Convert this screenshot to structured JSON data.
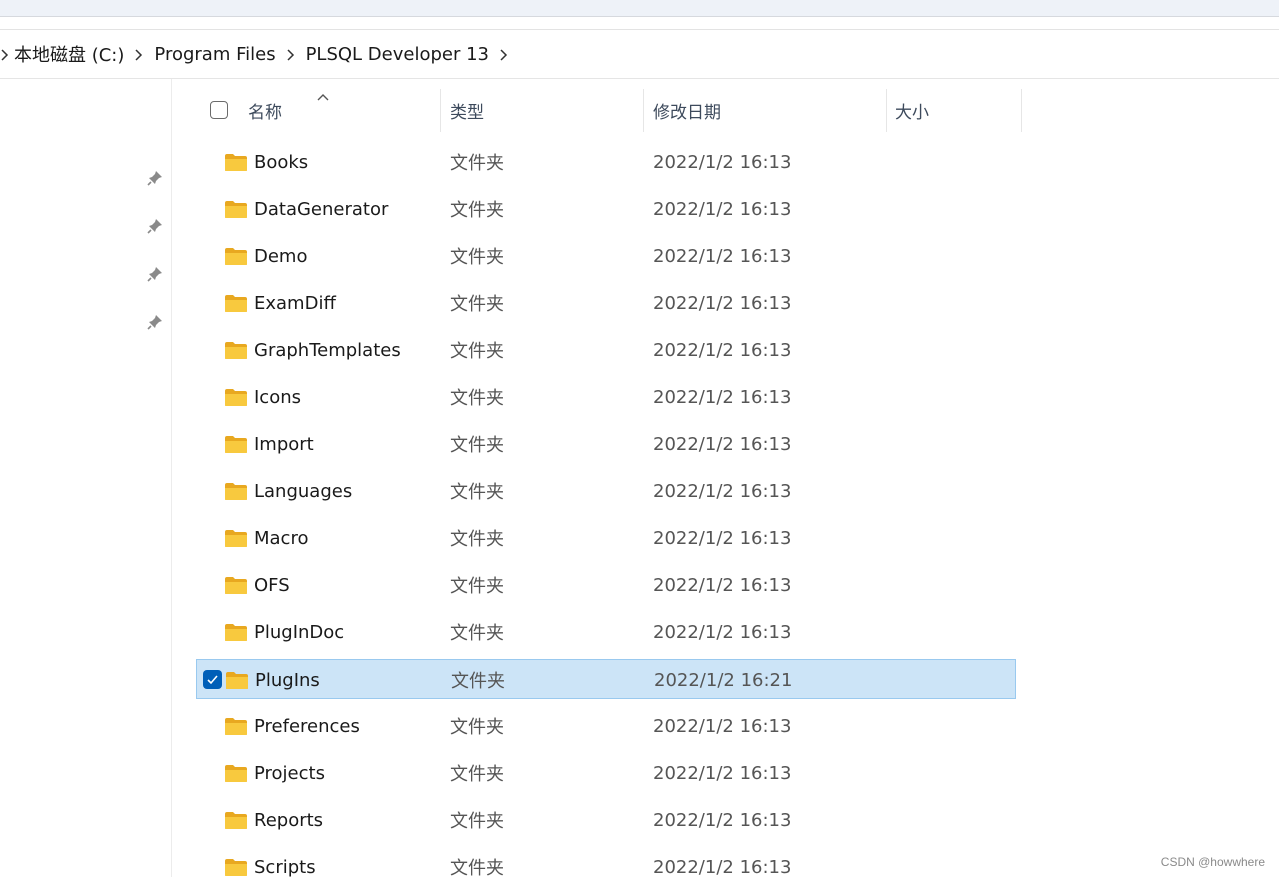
{
  "breadcrumb": {
    "items": [
      "本地磁盘 (C:)",
      "Program Files",
      "PLSQL Developer 13"
    ]
  },
  "columns": {
    "name": "名称",
    "type": "类型",
    "date": "修改日期",
    "size": "大小"
  },
  "files": [
    {
      "name": "Books",
      "type": "文件夹",
      "date": "2022/1/2 16:13",
      "selected": false
    },
    {
      "name": "DataGenerator",
      "type": "文件夹",
      "date": "2022/1/2 16:13",
      "selected": false
    },
    {
      "name": "Demo",
      "type": "文件夹",
      "date": "2022/1/2 16:13",
      "selected": false
    },
    {
      "name": "ExamDiff",
      "type": "文件夹",
      "date": "2022/1/2 16:13",
      "selected": false
    },
    {
      "name": "GraphTemplates",
      "type": "文件夹",
      "date": "2022/1/2 16:13",
      "selected": false
    },
    {
      "name": "Icons",
      "type": "文件夹",
      "date": "2022/1/2 16:13",
      "selected": false
    },
    {
      "name": "Import",
      "type": "文件夹",
      "date": "2022/1/2 16:13",
      "selected": false
    },
    {
      "name": "Languages",
      "type": "文件夹",
      "date": "2022/1/2 16:13",
      "selected": false
    },
    {
      "name": "Macro",
      "type": "文件夹",
      "date": "2022/1/2 16:13",
      "selected": false
    },
    {
      "name": "OFS",
      "type": "文件夹",
      "date": "2022/1/2 16:13",
      "selected": false
    },
    {
      "name": "PlugInDoc",
      "type": "文件夹",
      "date": "2022/1/2 16:13",
      "selected": false
    },
    {
      "name": "PlugIns",
      "type": "文件夹",
      "date": "2022/1/2 16:21",
      "selected": true
    },
    {
      "name": "Preferences",
      "type": "文件夹",
      "date": "2022/1/2 16:13",
      "selected": false
    },
    {
      "name": "Projects",
      "type": "文件夹",
      "date": "2022/1/2 16:13",
      "selected": false
    },
    {
      "name": "Reports",
      "type": "文件夹",
      "date": "2022/1/2 16:13",
      "selected": false
    },
    {
      "name": "Scripts",
      "type": "文件夹",
      "date": "2022/1/2 16:13",
      "selected": false
    }
  ],
  "nav_pins": [
    "pin-icon",
    "pin-icon",
    "pin-icon",
    "pin-icon"
  ],
  "watermark": "CSDN @howwhere",
  "colors": {
    "selection_bg": "#cce4f7",
    "selection_border": "#99c9ef",
    "checkbox_accent": "#005fb8",
    "folder_yellow": "#f8c93e"
  }
}
